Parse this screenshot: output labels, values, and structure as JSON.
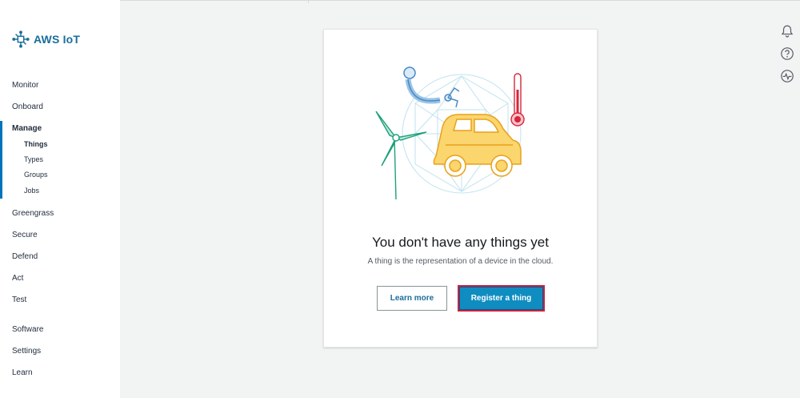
{
  "app": {
    "name": "AWS IoT",
    "brand_color": "#1a6e9c",
    "accent_color": "#0073bb"
  },
  "sidebar": {
    "items": [
      {
        "label": "Monitor"
      },
      {
        "label": "Onboard"
      },
      {
        "label": "Manage",
        "active": true
      },
      {
        "label": "Greengrass"
      },
      {
        "label": "Secure"
      },
      {
        "label": "Defend"
      },
      {
        "label": "Act"
      },
      {
        "label": "Test"
      },
      {
        "label": "Software"
      },
      {
        "label": "Settings"
      },
      {
        "label": "Learn"
      }
    ],
    "manage_sub": [
      {
        "label": "Things",
        "active": true
      },
      {
        "label": "Types"
      },
      {
        "label": "Groups"
      },
      {
        "label": "Jobs"
      }
    ]
  },
  "toolbar_icons": [
    "bell-icon",
    "help-icon",
    "activity-icon"
  ],
  "empty_state": {
    "title": "You don't have any things yet",
    "subtitle": "A thing is the representation of a device in the cloud.",
    "learn_more_label": "Learn more",
    "register_label": "Register a thing",
    "illustration": "iot-devices-illustration"
  }
}
